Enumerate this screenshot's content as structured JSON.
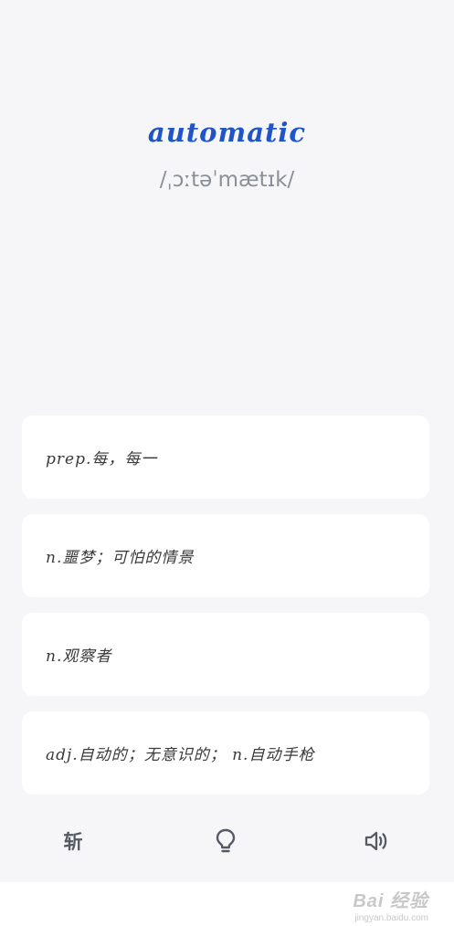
{
  "word": "automatic",
  "phonetic": "/ˌɔːtəˈmætɪk/",
  "options": [
    "prep.每，每一",
    "n.噩梦；可怕的情景",
    "n.观察者",
    "adj.自动的；无意识的； n.自动手枪"
  ],
  "toolbar": {
    "cut_label": "斩",
    "cut_icon": "cut-text-icon",
    "hint_icon": "lightbulb-icon",
    "sound_icon": "speaker-icon"
  },
  "watermark": {
    "main": "Bai 经验",
    "sub": "jingyan.baidu.com"
  },
  "colors": {
    "accent": "#1f55c7",
    "background": "#f6f6f8",
    "card": "#ffffff",
    "icon": "#555a63"
  }
}
